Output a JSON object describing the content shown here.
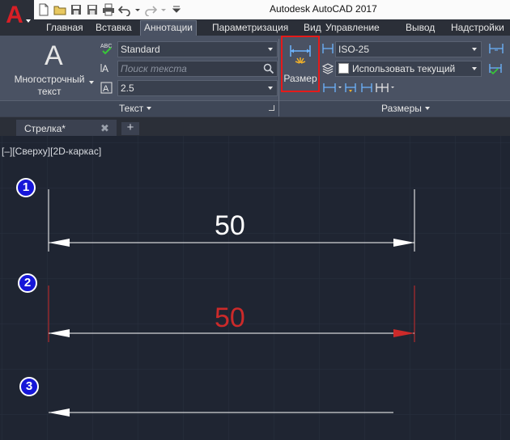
{
  "window": {
    "title": "Autodesk AutoCAD 2017"
  },
  "app_button": {
    "glyph": "A"
  },
  "ribbon_tabs": [
    {
      "label": "Главная",
      "active": false
    },
    {
      "label": "Вставка",
      "active": false
    },
    {
      "label": "Аннотации",
      "active": true
    },
    {
      "label": "Параметризация",
      "active": false
    },
    {
      "label": "Вид",
      "active": false
    },
    {
      "label": "Управление",
      "active": false
    },
    {
      "label": "Вывод",
      "active": false
    },
    {
      "label": "Надстройки",
      "active": false
    }
  ],
  "text_panel": {
    "mtext_glyph": "A",
    "mtext_label": "Многострочный\nтекст",
    "style": "Standard",
    "search_placeholder": "Поиск текста",
    "height": "2.5",
    "title": "Текст"
  },
  "dim_panel": {
    "razmer_label": "Размер",
    "dim_style": "ISO-25",
    "layer": "Использовать текущий",
    "title": "Размеры"
  },
  "doc_tab": {
    "label": "Стрелка*",
    "close": "✖",
    "new_tab": "+"
  },
  "viewport": {
    "label": "[–][Сверху][2D-каркас]"
  },
  "annotations": [
    {
      "number": "1",
      "dim_value": "50",
      "color": "#ffffff"
    },
    {
      "number": "2",
      "dim_value": "50",
      "color": "#cc2a2a"
    },
    {
      "number": "3"
    }
  ],
  "colors": {
    "dim_white": "#ffffff",
    "dim_red": "#cc2a2a",
    "highlight": "#e51a1a",
    "marker_blue": "#1616d8"
  }
}
